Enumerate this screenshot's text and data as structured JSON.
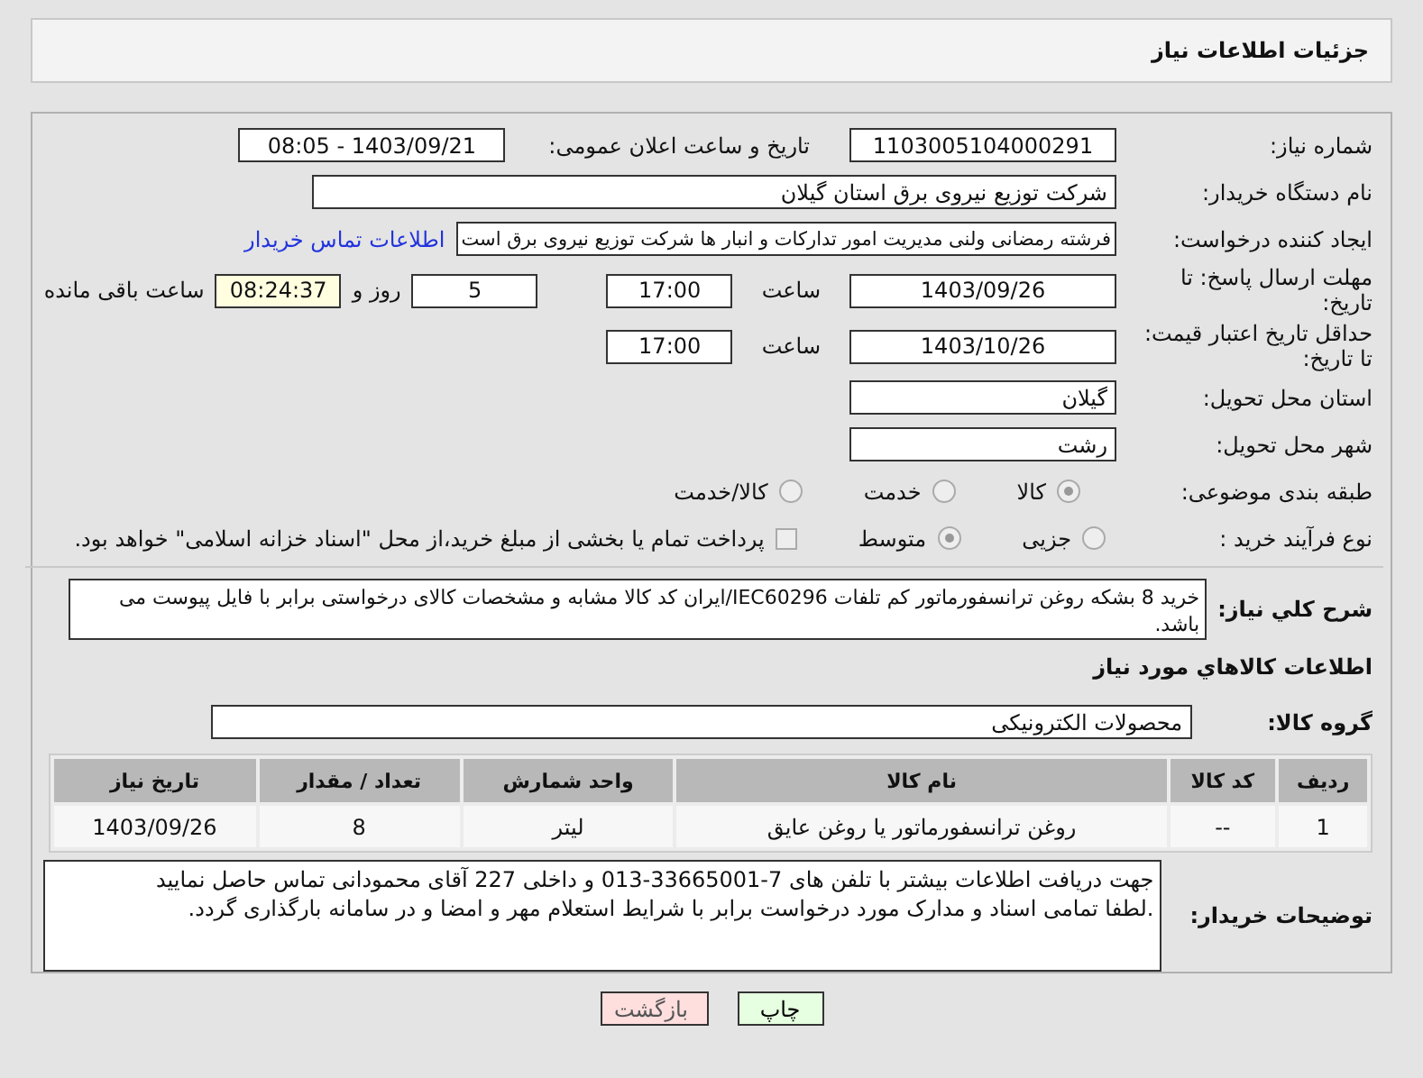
{
  "header": {
    "title": "جزئیات اطلاعات نیاز"
  },
  "need_number": {
    "label": "شماره نیاز:",
    "value": "1103005104000291"
  },
  "announce": {
    "label": "تاریخ و ساعت اعلان عمومی:",
    "value": "1403/09/21 - 08:05"
  },
  "buyer": {
    "label": "نام دستگاه خریدار:",
    "value": "شرکت توزیع نیروی برق استان گیلان"
  },
  "creator": {
    "label": "ایجاد کننده درخواست:",
    "value": "فرشته رمضانی ولنی مدیریت امور تدارکات و انبار ها شرکت توزیع نیروی برق است",
    "link": "اطلاعات تماس خریدار"
  },
  "deadline": {
    "label": "مهلت ارسال پاسخ: تا تاریخ:",
    "date": "1403/09/26",
    "time_label": "ساعت",
    "time": "17:00",
    "days": "5",
    "days_label": "روز و",
    "remaining": "08:24:37",
    "remaining_label": "ساعت باقی مانده"
  },
  "validity": {
    "label": "حداقل تاریخ اعتبار قیمت: تا تاریخ:",
    "date": "1403/10/26",
    "time_label": "ساعت",
    "time": "17:00"
  },
  "province": {
    "label": "استان محل تحویل:",
    "value": "گیلان"
  },
  "city": {
    "label": "شهر محل تحویل:",
    "value": "رشت"
  },
  "category": {
    "label": "طبقه بندی موضوعی:",
    "options": [
      {
        "label": "کالا",
        "selected": true
      },
      {
        "label": "خدمت",
        "selected": false
      },
      {
        "label": "کالا/خدمت",
        "selected": false
      }
    ]
  },
  "process": {
    "label": "نوع فرآیند خرید :",
    "options": [
      {
        "label": "جزیی",
        "selected": false
      },
      {
        "label": "متوسط",
        "selected": true
      }
    ],
    "payment": {
      "label": "پرداخت تمام یا بخشی از مبلغ خرید،از محل \"اسناد خزانه اسلامی\" خواهد بود.",
      "checked": false
    }
  },
  "description": {
    "label": "شرح کلي نياز:",
    "value": "خرید 8 بشکه روغن ترانسفورماتور کم تلفات IEC60296/ایران کد کالا مشابه و مشخصات کالای درخواستی برابر با فایل پیوست می باشد."
  },
  "items_heading": "اطلاعات كالاهاي مورد نياز",
  "goods_group": {
    "label": "گروه کالا:",
    "value": "محصولات الکترونیکی"
  },
  "table": {
    "columns": [
      "ردیف",
      "کد کالا",
      "نام کالا",
      "واحد شمارش",
      "تعداد / مقدار",
      "تاریخ نیاز"
    ],
    "rows": [
      [
        "1",
        "--",
        "روغن ترانسفورماتور یا روغن عایق",
        "لیتر",
        "8",
        "1403/09/26"
      ]
    ]
  },
  "buyer_notes": {
    "label": "توضیحات خریدار:",
    "value": "جهت دریافت اطلاعات بیشتر با تلفن های 7-33665001-013 و داخلی 227 آقای محمودانی تماس حاصل نمایید\n.لطفا تمامی اسناد و مدارک مورد درخواست برابر با شرایط استعلام مهر و امضا و در سامانه بارگذاری گردد."
  },
  "buttons": [
    {
      "label": "چاپ",
      "kind": "print"
    },
    {
      "label": "بازگشت",
      "kind": "back"
    }
  ]
}
